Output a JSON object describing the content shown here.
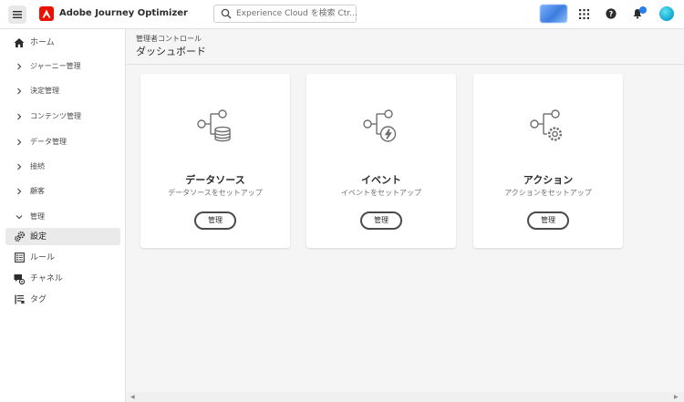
{
  "header": {
    "app_title": "Adobe Journey Optimizer",
    "search_placeholder": "Experience Cloud を検索 Ctr..."
  },
  "sidebar": {
    "items": [
      {
        "label": "ホーム",
        "icon": "home-icon"
      },
      {
        "label": "ジャーニー管理",
        "icon": "chevron-right-icon"
      },
      {
        "label": "決定管理",
        "icon": "chevron-right-icon"
      },
      {
        "label": "コンテンツ管理",
        "icon": "chevron-right-icon"
      },
      {
        "label": "データ管理",
        "icon": "chevron-right-icon"
      },
      {
        "label": "接続",
        "icon": "chevron-right-icon"
      },
      {
        "label": "顧客",
        "icon": "chevron-right-icon"
      },
      {
        "label": "管理",
        "icon": "chevron-down-icon"
      },
      {
        "label": "設定",
        "icon": "gears-icon",
        "active": true
      },
      {
        "label": "ルール",
        "icon": "rules-icon"
      },
      {
        "label": "チャネル",
        "icon": "channel-icon"
      },
      {
        "label": "タグ",
        "icon": "tags-icon"
      }
    ]
  },
  "main": {
    "breadcrumb": "管理者コントロール",
    "title": "ダッシュボード",
    "cards": [
      {
        "title": "データソース",
        "description": "データソースをセットアップ",
        "button": "管理",
        "icon": "datasource-icon"
      },
      {
        "title": "イベント",
        "description": "イベントをセットアップ",
        "button": "管理",
        "icon": "event-icon"
      },
      {
        "title": "アクション",
        "description": "アクションをセットアップ",
        "button": "管理",
        "icon": "action-icon"
      }
    ]
  }
}
